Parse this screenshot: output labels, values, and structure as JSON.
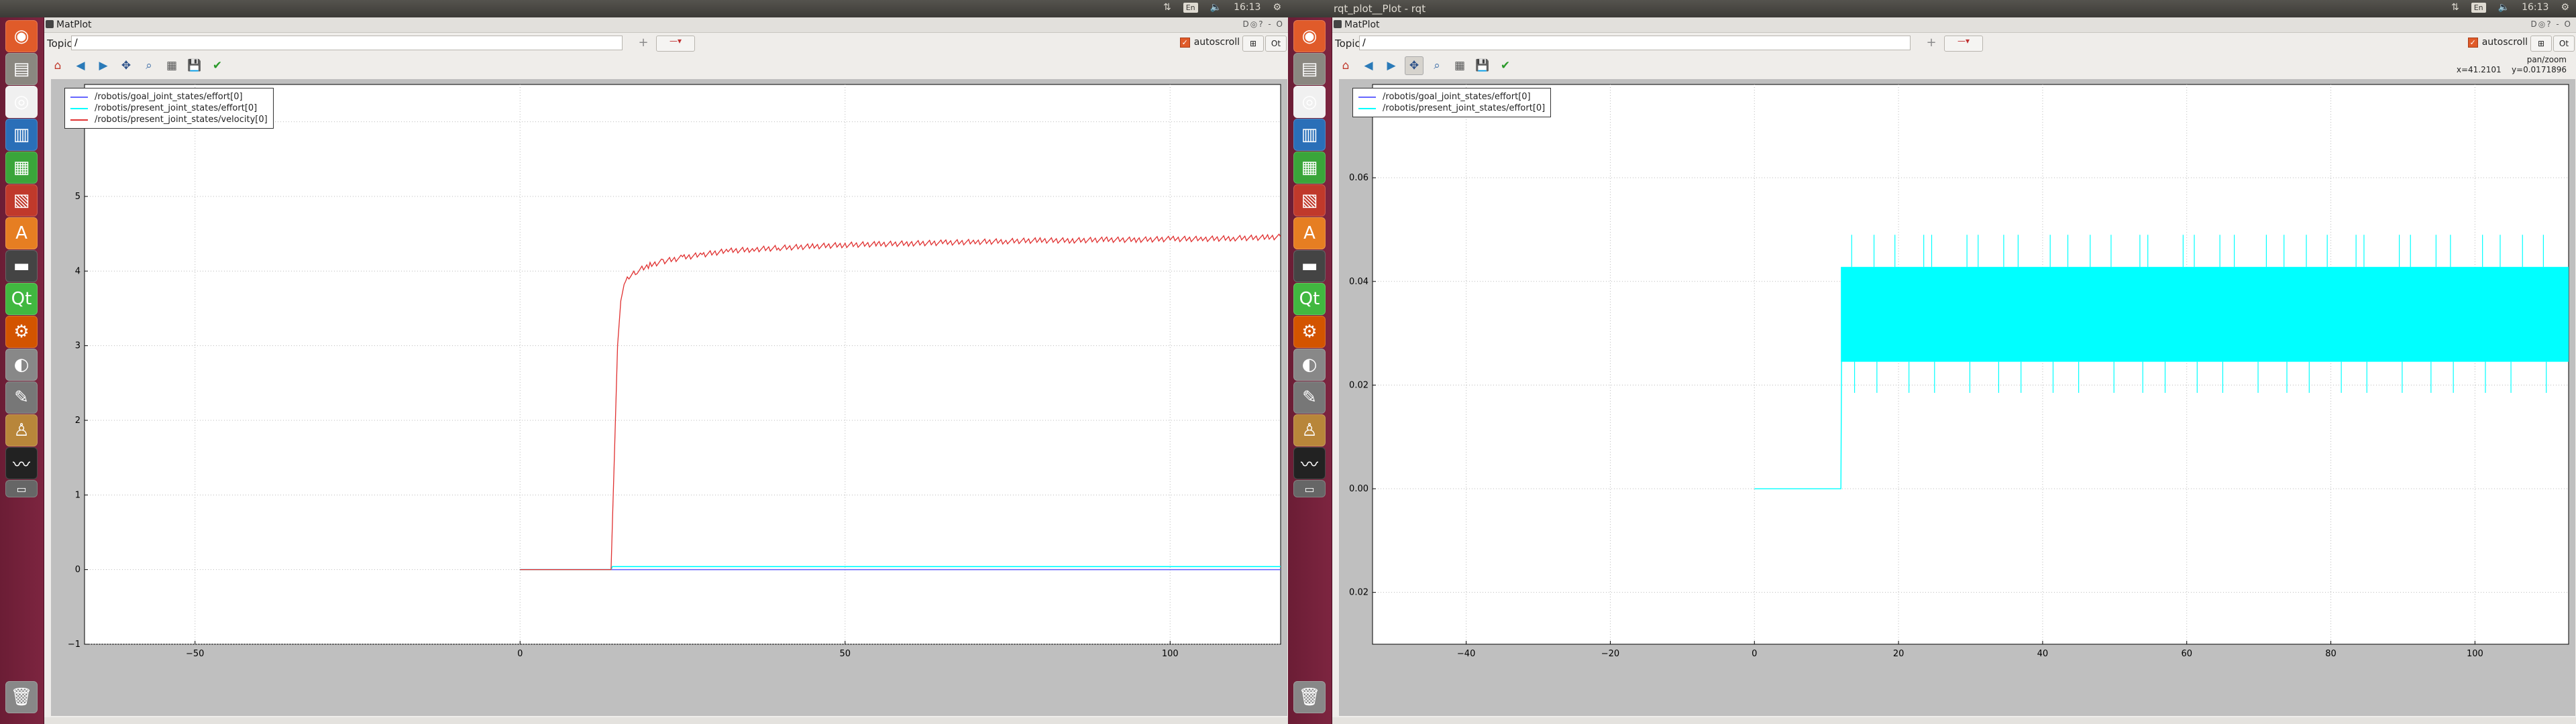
{
  "panel": {
    "left_title": "",
    "right_title": "rqt_plot__Plot - rqt",
    "lang": "En",
    "time": "16:13"
  },
  "left_window": {
    "title": "MatPlot",
    "topic_label": "Topic",
    "topic_value": "/",
    "autoscroll_label": "autoscroll",
    "status_mode": "",
    "status_x": "",
    "status_y": ""
  },
  "right_window": {
    "title": "MatPlot",
    "topic_label": "Topic",
    "topic_value": "/",
    "autoscroll_label": "autoscroll",
    "status_mode": "pan/zoom",
    "status_x": "x=41.2101",
    "status_y": "y=0.0171896"
  },
  "buttons": {
    "add": "+",
    "remove": "—▾",
    "ok_a": "⊞",
    "ok_b": "Ot"
  },
  "toolbar_icons": [
    "home-icon",
    "back-icon",
    "forward-icon",
    "pan-icon",
    "zoom-icon",
    "configure-icon",
    "save-icon",
    "check-icon"
  ],
  "launcher_icons": [
    "ubuntu-dash-icon",
    "files-icon",
    "chrome-icon",
    "writer-icon",
    "calc-icon",
    "impress-icon",
    "software-center-icon",
    "terminal-icon",
    "qt-creator-icon",
    "settings-icon",
    "eye-icon",
    "text-editor-icon",
    "user-manual-icon",
    "system-monitor-icon",
    "workspace-icon",
    "trash-icon"
  ],
  "colors": {
    "goal_effort": "#6666ff",
    "present_effort": "#00ffff",
    "present_velocity": "#e03030",
    "launcher": "#7d2540",
    "accent": "#e05b2a"
  },
  "chart_data": [
    {
      "type": "line",
      "title": "",
      "xlabel": "",
      "ylabel": "",
      "xlim": [
        -67,
        117
      ],
      "ylim": [
        -1,
        6.5
      ],
      "xticks": [
        -50,
        0,
        50,
        100
      ],
      "yticks": [
        -1,
        0,
        1,
        2,
        3,
        4,
        5,
        6
      ],
      "grid": true,
      "legend": "top-left",
      "series": [
        {
          "name": "/robotis/goal_joint_states/effort[0]",
          "color": "#6666ff",
          "x": [
            0,
            117
          ],
          "y": [
            0,
            0
          ]
        },
        {
          "name": "/robotis/present_joint_states/effort[0]",
          "color": "#00ffff",
          "x": [
            0,
            14,
            14.2,
            117
          ],
          "y": [
            0,
            0,
            0.04,
            0.04
          ]
        },
        {
          "name": "/robotis/present_joint_states/velocity[0]",
          "color": "#e03030",
          "x": [
            0,
            14,
            14.5,
            15,
            15.5,
            16,
            17,
            18,
            20,
            22,
            25,
            28,
            32,
            36,
            40,
            45,
            50,
            55,
            60,
            65,
            70,
            75,
            80,
            85,
            90,
            95,
            100,
            105,
            110,
            115,
            117
          ],
          "y": [
            0,
            0,
            1.5,
            3.0,
            3.6,
            3.82,
            3.95,
            4.0,
            4.08,
            4.13,
            4.18,
            4.22,
            4.27,
            4.29,
            4.31,
            4.33,
            4.35,
            4.36,
            4.37,
            4.38,
            4.39,
            4.4,
            4.41,
            4.41,
            4.42,
            4.42,
            4.43,
            4.43,
            4.44,
            4.45,
            4.46
          ]
        }
      ]
    },
    {
      "type": "line",
      "title": "",
      "xlabel": "",
      "ylabel": "",
      "xlim": [
        -53,
        113
      ],
      "ylim": [
        -0.03,
        0.078
      ],
      "xticks": [
        -40,
        -20,
        0,
        20,
        40,
        60,
        80,
        100
      ],
      "yticks": [
        -0.02,
        0.0,
        0.02,
        0.04,
        0.06
      ],
      "ytick_labels": [
        "0.02",
        "0.00",
        "0.02",
        "0.04",
        "0.06"
      ],
      "grid": true,
      "legend": "top-left",
      "series": [
        {
          "name": "/robotis/goal_joint_states/effort[0]",
          "color": "#6666ff",
          "x": [],
          "y": []
        },
        {
          "name": "/robotis/present_joint_states/effort[0]",
          "color": "#00ffff",
          "x": [
            0,
            12,
            12.1,
            113
          ],
          "y": [
            0,
            0,
            0.025,
            0.025
          ],
          "band": {
            "x_start": 12,
            "x_end": 113,
            "low": 0.0245,
            "high": 0.0428,
            "spike_high": 0.049,
            "spike_low": 0.0185
          }
        }
      ]
    }
  ]
}
